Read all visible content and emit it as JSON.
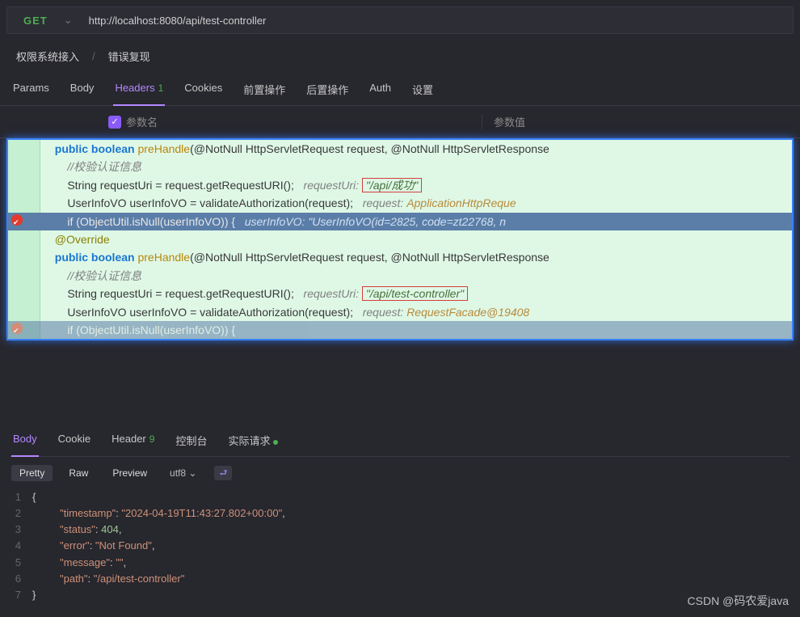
{
  "request": {
    "method": "GET",
    "url": "http://localhost:8080/api/test-controller"
  },
  "breadcrumb": {
    "root": "权限系统接入",
    "leaf": "错误复现"
  },
  "reqTabs": {
    "params": "Params",
    "body": "Body",
    "headers": "Headers",
    "headersCount": "1",
    "cookies": "Cookies",
    "pre": "前置操作",
    "post": "后置操作",
    "auth": "Auth",
    "settings": "设置"
  },
  "headerCols": {
    "name": "参数名",
    "value": "参数值"
  },
  "code": {
    "block1": {
      "sig_pre": "public",
      "sig_ret": "boolean",
      "sig_name": "preHandle",
      "sig_params": "(@NotNull HttpServletRequest request, @NotNull HttpServletResponse",
      "comment": "//校验认证信息",
      "l3_a": "String requestUri = request.getRequestURI();",
      "l3_hint_k": "requestUri:",
      "l3_hint_v": "\"/api/成功\"",
      "l4_a": "UserInfoVO userInfoVO = validateAuthorization(request);",
      "l4_hint_k": "request:",
      "l4_hint_v": "ApplicationHttpReque",
      "exec_a": "if (ObjectUtil.isNull(userInfoVO)) {",
      "exec_hint": "userInfoVO: \"UserInfoVO(id=2825, code=zt22768, n"
    },
    "block2": {
      "override": "@Override",
      "sig_pre": "public",
      "sig_ret": "boolean",
      "sig_name": "preHandle",
      "sig_params": "(@NotNull HttpServletRequest request, @NotNull HttpServletResponse",
      "comment": "//校验认证信息",
      "l3_a": "String requestUri = request.getRequestURI();",
      "l3_hint_k": "requestUri:",
      "l3_hint_v": "\"/api/test-controller\"",
      "l4_a": "UserInfoVO userInfoVO = validateAuthorization(request);",
      "l4_hint_k": "request:",
      "l4_hint_v": "RequestFacade@19408",
      "exec_a": "if (ObjectUtil.isNull(userInfoVO)) {"
    }
  },
  "respTabs": {
    "body": "Body",
    "cookie": "Cookie",
    "header": "Header",
    "headerCount": "9",
    "console": "控制台",
    "actual": "实际请求"
  },
  "viewRow": {
    "pretty": "Pretty",
    "raw": "Raw",
    "preview": "Preview",
    "enc": "utf8"
  },
  "jsonResponse": {
    "lines": [
      "{",
      "\"timestamp\": \"2024-04-19T11:43:27.802+00:00\",",
      "\"status\": 404,",
      "\"error\": \"Not Found\",",
      "\"message\": \"\",",
      "\"path\": \"/api/test-controller\"",
      "}"
    ],
    "timestamp_k": "\"timestamp\"",
    "timestamp_v": "\"2024-04-19T11:43:27.802+00:00\"",
    "status_k": "\"status\"",
    "status_v": "404",
    "error_k": "\"error\"",
    "error_v": "\"Not Found\"",
    "message_k": "\"message\"",
    "message_v": "\"\"",
    "path_k": "\"path\"",
    "path_v": "\"/api/test-controller\""
  },
  "watermark": "CSDN @码农爱java"
}
